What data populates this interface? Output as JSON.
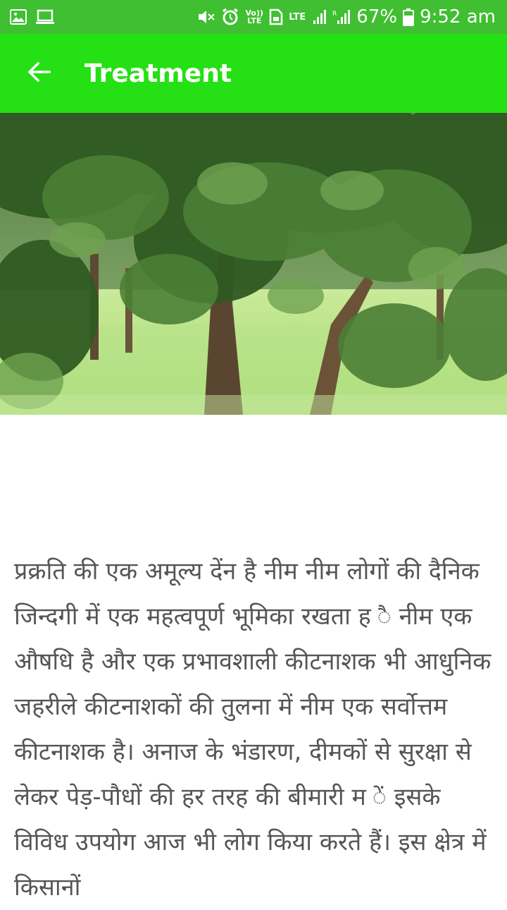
{
  "status_bar": {
    "battery_percent": "67%",
    "time": "9:52 am",
    "volte_label": "Vo)) LTE",
    "lte_label": "LTE",
    "icons": [
      "image-notification-icon",
      "laptop-notification-icon",
      "mute-icon",
      "alarm-icon",
      "volte-icon",
      "sim-icon",
      "lte-icon",
      "signal-icon",
      "roaming-signal-icon",
      "battery-icon"
    ]
  },
  "app_bar": {
    "title": "Treatment",
    "back_icon": "back-arrow-icon"
  },
  "hero_image": {
    "alt": "neem tree"
  },
  "article": {
    "text": "प्रक्रति की एक अमूल्य देंन है नीम नीम लोगों की दैनिक जिन्दगी में एक महत्वपूर्ण भूमिका रखता ह ै नीम एक औषधि है और एक प्रभावशाली कीटनाशक भी आधुनिक जहरीले कीटनाशकों की तुलना में नीम एक सर्वोत्तम कीटनाशक है। अनाज के भंडारण, दीमकों से सुरक्षा से लेकर पेड़-पौधों की हर तरह की बीमारी म ें इसके विविध उपयोग आज भी लोग किया करते हैं। इस क्षेत्र में किसानों"
  },
  "colors": {
    "status_bar": "#3fbf31",
    "app_bar": "#24e014",
    "text": "#555555"
  }
}
